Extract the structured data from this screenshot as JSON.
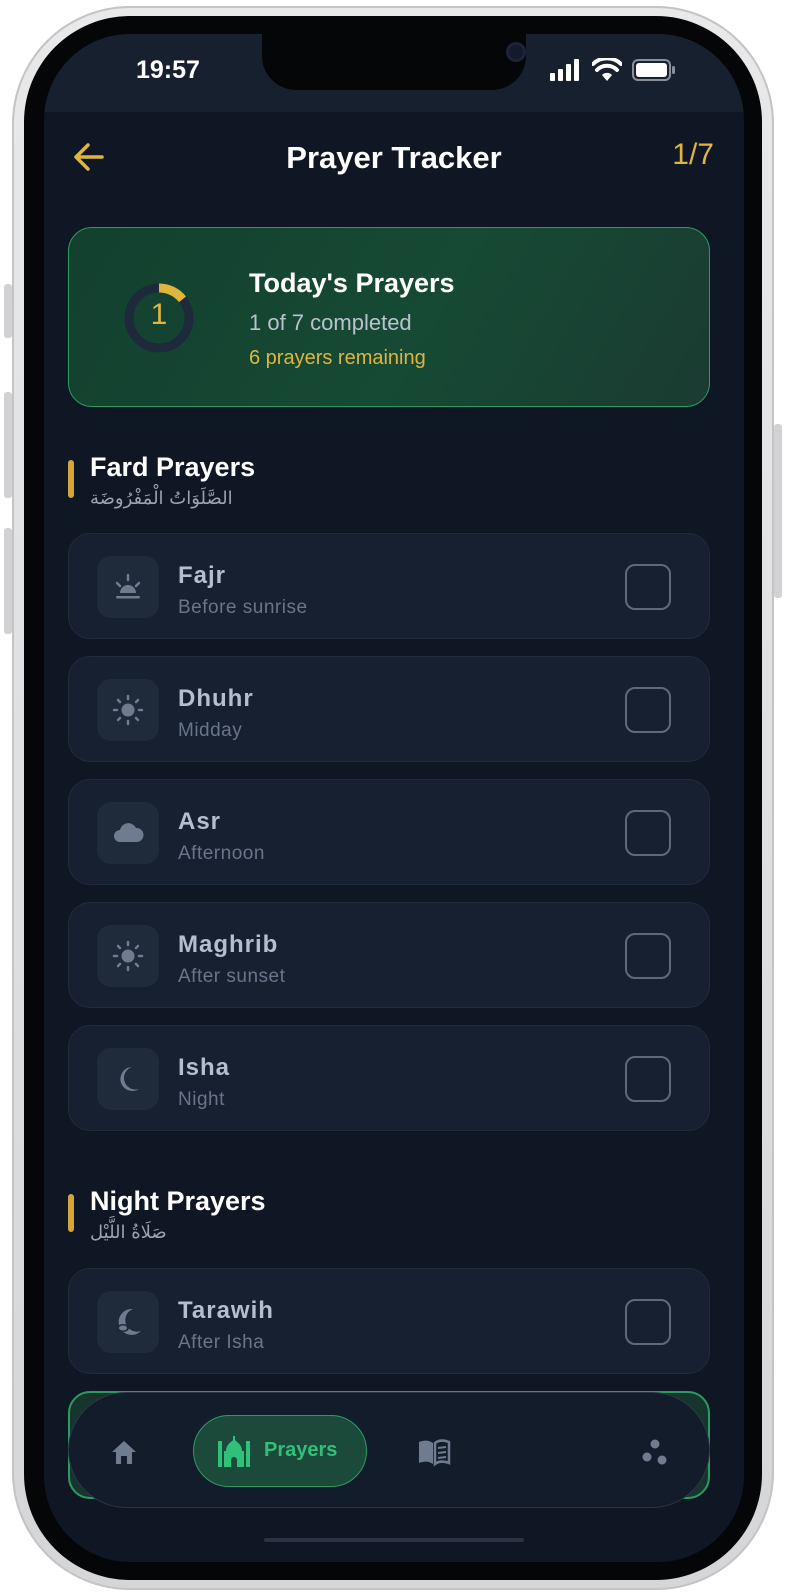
{
  "status": {
    "time": "19:57"
  },
  "header": {
    "title": "Prayer Tracker",
    "count": "1/7"
  },
  "summary": {
    "completed_value": "1",
    "title": "Today's Prayers",
    "subtitle": "1 of 7 completed",
    "remaining": "6 prayers remaining",
    "progress_fraction": 0.143
  },
  "sections": [
    {
      "title": "Fard Prayers",
      "arabic": "الصَّلَوَاتُ الْمَفْرُوضَة",
      "items": [
        {
          "name": "Fajr",
          "time": "Before sunrise",
          "icon": "sunrise-icon",
          "checked": false
        },
        {
          "name": "Dhuhr",
          "time": "Midday",
          "icon": "sun-icon",
          "checked": false
        },
        {
          "name": "Asr",
          "time": "Afternoon",
          "icon": "cloud-icon",
          "checked": false
        },
        {
          "name": "Maghrib",
          "time": "After sunset",
          "icon": "sun-icon",
          "checked": false
        },
        {
          "name": "Isha",
          "time": "Night",
          "icon": "moon-icon",
          "checked": false
        }
      ]
    },
    {
      "title": "Night Prayers",
      "arabic": "صَلَاةُ اللَّيْل",
      "items": [
        {
          "name": "Tarawih",
          "time": "After Isha",
          "icon": "moon-stars-icon",
          "checked": false
        }
      ]
    }
  ],
  "nav": {
    "items": [
      "home-icon",
      "mosque-icon",
      "book-icon",
      "moon-icon",
      "dots-icon"
    ],
    "active_label": "Prayers"
  },
  "colors": {
    "accent": "#e0b53e",
    "green": "#2fc07a",
    "background": "#0f1624",
    "card": "#172030"
  }
}
